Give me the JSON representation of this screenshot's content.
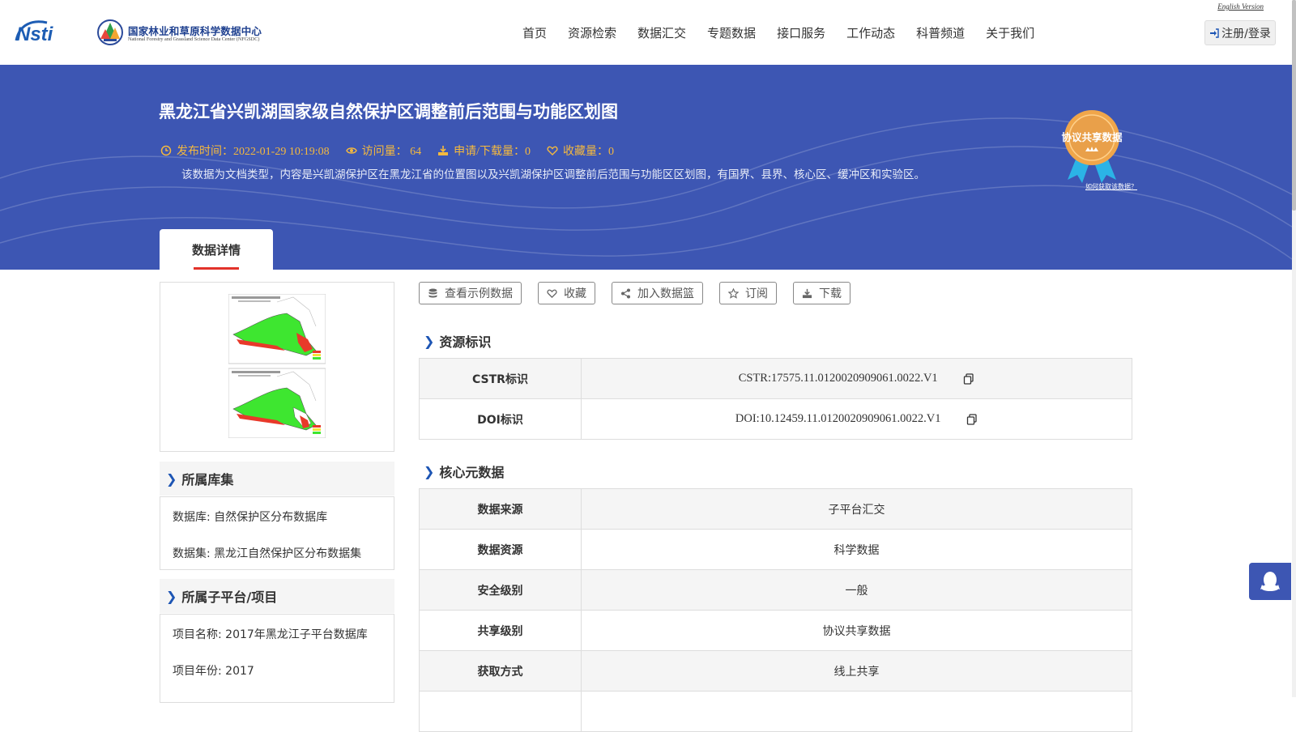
{
  "header": {
    "english_version": "English Version",
    "logo_nsti": "Nsti",
    "logo_cn": "国家林业和草原科学数据中心",
    "logo_en": "National Forestry and Grassland Science Data Center (NFGSDC)",
    "nav": [
      "首页",
      "资源检索",
      "数据汇交",
      "专题数据",
      "接口服务",
      "工作动态",
      "科普频道",
      "关于我们"
    ],
    "login": "注册/登录"
  },
  "banner": {
    "title": "黑龙江省兴凯湖国家级自然保护区调整前后范围与功能区划图",
    "publish_time": "发布时间：2022-01-29 10:19:08",
    "views": "访问量： 64",
    "downloads": "申请/下载量：0",
    "favorites": "收藏量：0",
    "description": "该数据为文档类型，内容是兴凯湖保护区在黑龙江省的位置图以及兴凯湖保护区调整前后范围与功能区区划图，有国界、县界、核心区、缓冲区和实验区。",
    "badge_text": "协议共享数据",
    "badge_link": "如何获取该数据？",
    "tab_detail": "数据详情"
  },
  "left": {
    "library_head": "所属库集",
    "database": "数据库: 自然保护区分布数据库",
    "dataset": "数据集: 黑龙江自然保护区分布数据集",
    "platform_head": "所属子平台/项目",
    "project_name": "项目名称: 2017年黑龙江子平台数据库",
    "project_year": "项目年份: 2017"
  },
  "actions": [
    "查看示例数据",
    "收藏",
    "加入数据篮",
    "订阅",
    "下载"
  ],
  "resource_id": {
    "heading": "资源标识",
    "rows": [
      {
        "key": "CSTR标识",
        "value": "CSTR:17575.11.0120020909061.0022.V1"
      },
      {
        "key": "DOI标识",
        "value": "DOI:10.12459.11.0120020909061.0022.V1"
      }
    ]
  },
  "core_meta": {
    "heading": "核心元数据",
    "rows": [
      {
        "key": "数据来源",
        "value": "子平台汇交"
      },
      {
        "key": "数据资源",
        "value": "科学数据"
      },
      {
        "key": "安全级别",
        "value": "一般"
      },
      {
        "key": "共享级别",
        "value": "协议共享数据"
      },
      {
        "key": "获取方式",
        "value": "线上共享"
      }
    ]
  },
  "colors": {
    "banner_bg": "#3d56b3",
    "meta_accent": "#f5b93e",
    "tab_underline": "#e2322a",
    "chevron": "#1d55b4"
  }
}
